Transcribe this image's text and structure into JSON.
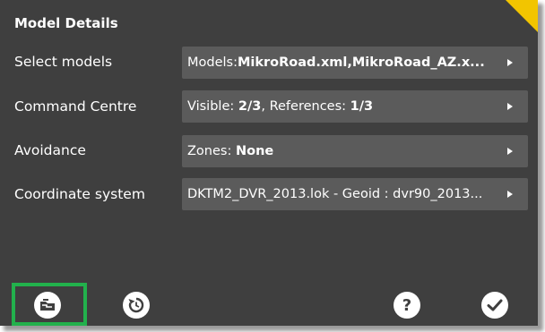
{
  "panel": {
    "title": "Model Details"
  },
  "rows": [
    {
      "label": "Select models",
      "value_prefix": "Models:",
      "value_bold": "MikroRoad.xml,MikroRoad_AZ.x...",
      "value_mid": "",
      "value_bold2": ""
    },
    {
      "label": "Command Centre",
      "value_prefix": "Visible: ",
      "value_bold": "2/3",
      "value_mid": ", References: ",
      "value_bold2": "1/3"
    },
    {
      "label": "Avoidance",
      "value_prefix": "Zones: ",
      "value_bold": "None",
      "value_mid": "",
      "value_bold2": ""
    },
    {
      "label": "Coordinate system",
      "value_prefix": "DKTM2_DVR_2013.lok - Geoid : dvr90_2013...",
      "value_bold": "",
      "value_mid": "",
      "value_bold2": ""
    }
  ],
  "toolbar": {
    "icons": [
      "load-model-icon",
      "reset-icon",
      "help-icon",
      "confirm-icon"
    ],
    "help_glyph": "?"
  },
  "colors": {
    "panel_bg": "#3f3f3f",
    "field_bg": "#5b5b5b",
    "accent_corner": "#f2c500",
    "highlight": "#22b14c"
  }
}
